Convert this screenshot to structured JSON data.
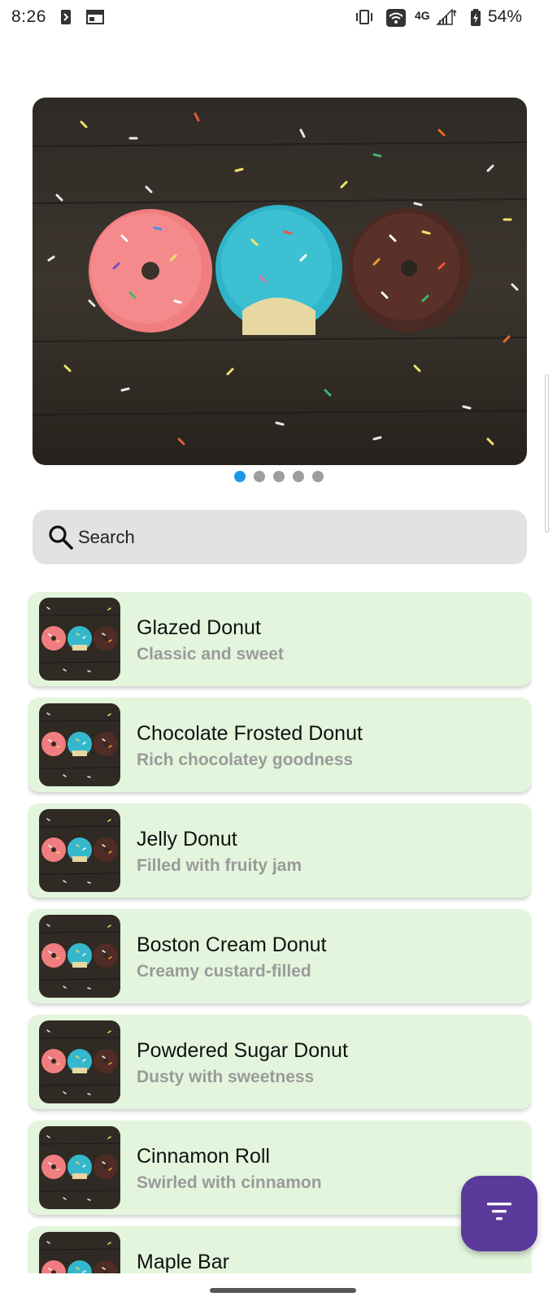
{
  "status_bar": {
    "time": "8:26",
    "network": "4G",
    "battery": "54%",
    "icons": [
      "app-notification-icon",
      "calendar-icon",
      "vibrate-icon",
      "wifi-icon",
      "signal-icon",
      "battery-icon"
    ]
  },
  "carousel": {
    "image": "donuts-on-wood-photo",
    "page_count": 5,
    "active_index": 0
  },
  "search": {
    "placeholder": "Search",
    "value": "",
    "icon": "search-icon"
  },
  "items": [
    {
      "title": "Glazed Donut",
      "subtitle": "Classic and sweet"
    },
    {
      "title": "Chocolate Frosted Donut",
      "subtitle": "Rich chocolatey goodness"
    },
    {
      "title": "Jelly Donut",
      "subtitle": "Filled with fruity jam"
    },
    {
      "title": "Boston Cream Donut",
      "subtitle": "Creamy custard-filled"
    },
    {
      "title": "Powdered Sugar Donut",
      "subtitle": "Dusty with sweetness"
    },
    {
      "title": "Cinnamon Roll",
      "subtitle": "Swirled with cinnamon"
    },
    {
      "title": "Maple Bar",
      "subtitle": ""
    }
  ],
  "fab": {
    "icon": "filter-icon"
  },
  "colors": {
    "card_bg": "#e3f6dd",
    "fab_bg": "#5b3a9b",
    "dot_active": "#1e96e6",
    "dot_inactive": "#9e9e9e",
    "search_bg": "#e2e2e2"
  }
}
